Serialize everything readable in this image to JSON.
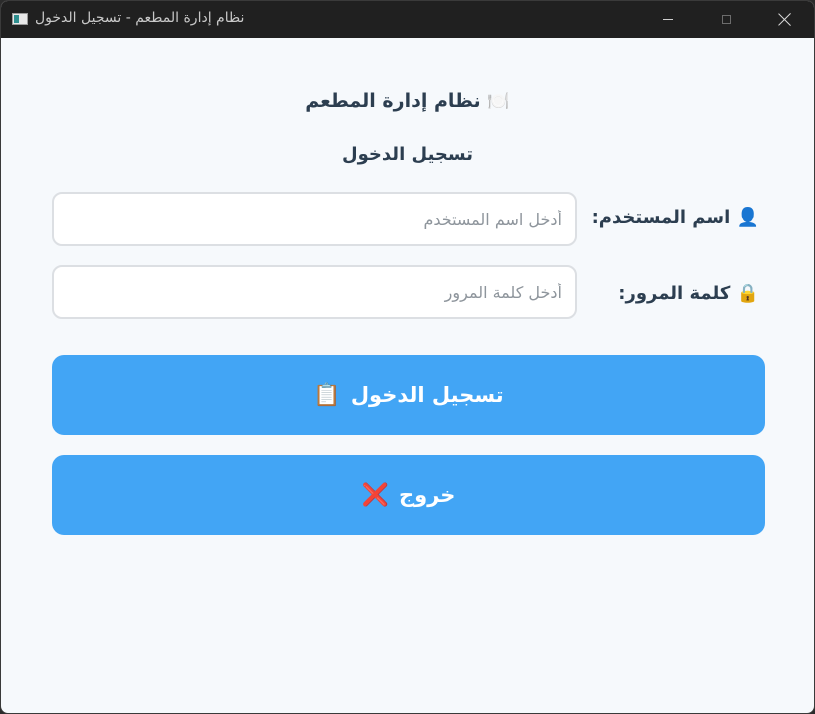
{
  "window": {
    "title": "نظام إدارة المطعم - تسجيل الدخول"
  },
  "header": {
    "icon": "🍽️",
    "app_title": "نظام إدارة المطعم",
    "subtitle": "تسجيل الدخول"
  },
  "form": {
    "username": {
      "icon": "👤",
      "label": "اسم المستخدم:",
      "value": "",
      "placeholder": "أدخل اسم المستخدم"
    },
    "password": {
      "icon": "🔒",
      "label": "كلمة المرور:",
      "value": "",
      "placeholder": "أدخل كلمة المرور"
    }
  },
  "buttons": {
    "login": {
      "label": "تسجيل الدخول",
      "icon": "📋"
    },
    "exit": {
      "label": "خروج",
      "icon": "❌"
    }
  },
  "colors": {
    "accent": "#42a5f5",
    "text": "#2c3e50",
    "background": "#f6f9fc",
    "titlebar": "#202020"
  }
}
